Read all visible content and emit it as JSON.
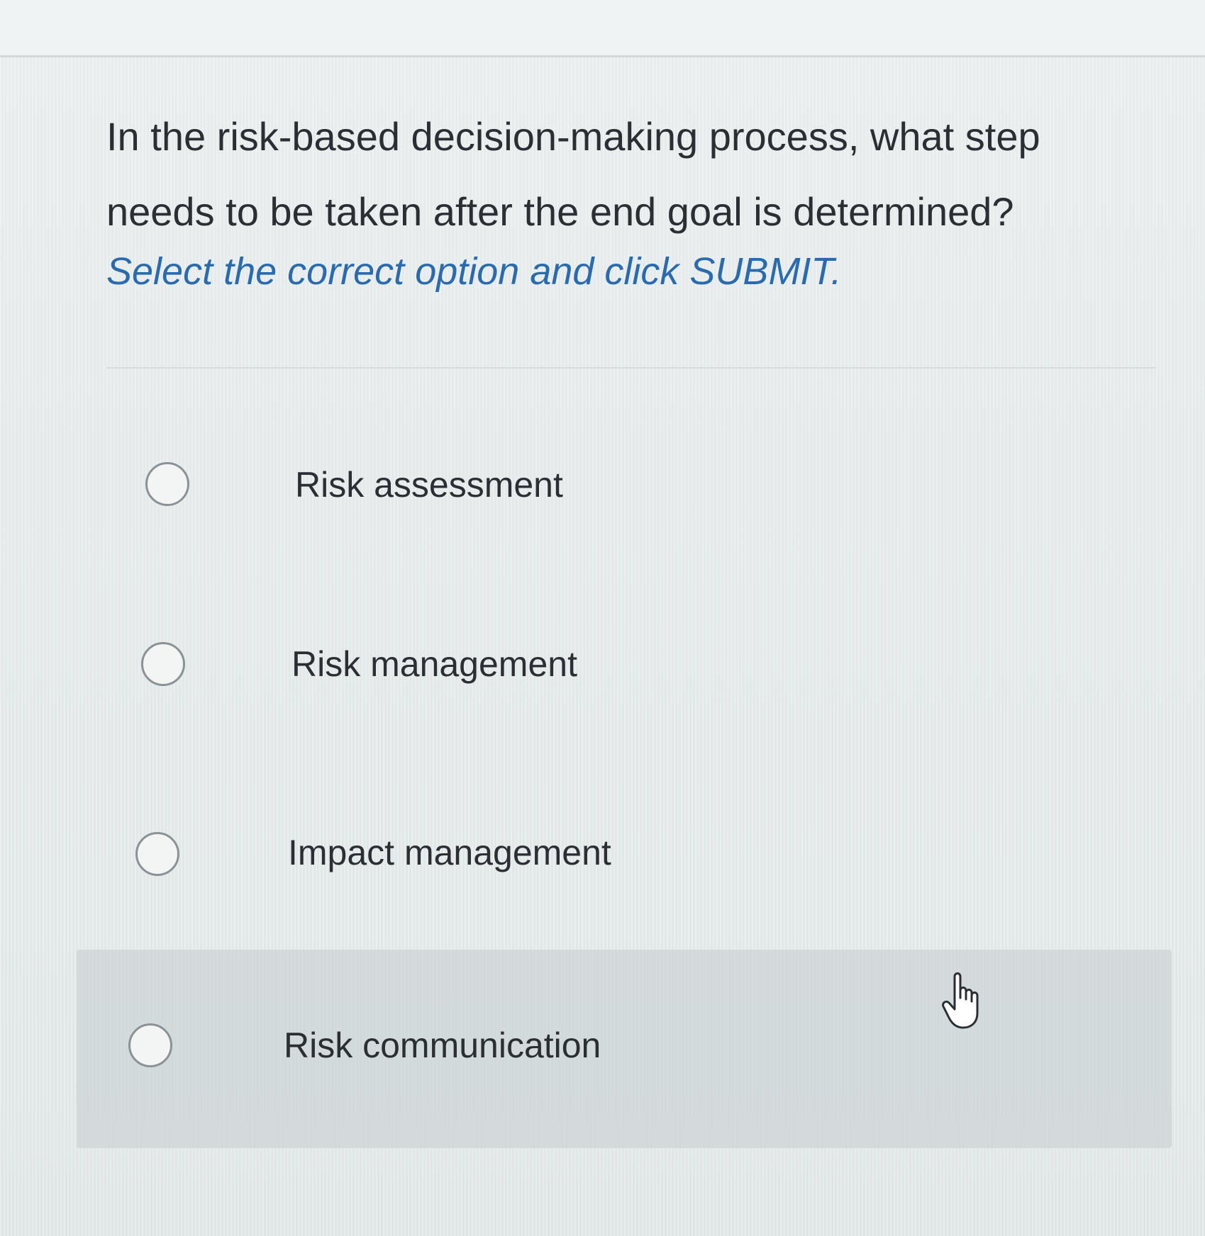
{
  "question": {
    "line1": "In the risk-based decision-making process, what step",
    "line2": "needs to be taken after the end goal is determined?",
    "instruction": "Select the correct option and click SUBMIT."
  },
  "options": [
    {
      "label": "Risk assessment",
      "selected": false
    },
    {
      "label": "Risk management",
      "selected": false
    },
    {
      "label": "Impact management",
      "selected": false
    },
    {
      "label": "Risk communication",
      "selected": false
    }
  ],
  "hovered_option_index": 3,
  "colors": {
    "instruction": "#2a6bb0",
    "text": "#2b2f33",
    "radio_border": "#8b9296"
  },
  "icons": {
    "cursor": "hand-pointer-icon"
  }
}
